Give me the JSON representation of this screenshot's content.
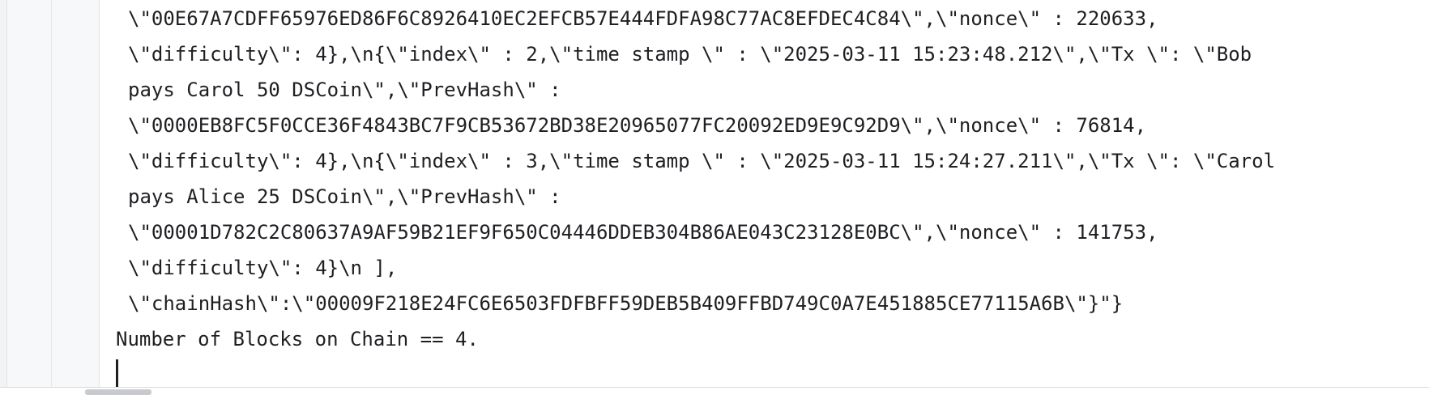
{
  "console": {
    "lines": [
      "\\\"00E67A7CDFF65976ED86F6C8926410EC2EFCB57E444FDFA98C77AC8EFDEC4C84\\\",\\\"nonce\\\" : 220633,",
      "\\\"difficulty\\\": 4},\\n{\\\"index\\\" : 2,\\\"time stamp \\\" : \\\"2025-03-11 15:23:48.212\\\",\\\"Tx \\\": \\\"Bob",
      "pays Carol 50 DSCoin\\\",\\\"PrevHash\\\" :",
      "\\\"0000EB8FC5F0CCE36F4843BC7F9CB53672BD38E20965077FC20092ED9E9C92D9\\\",\\\"nonce\\\" : 76814,",
      "\\\"difficulty\\\": 4},\\n{\\\"index\\\" : 3,\\\"time stamp \\\" : \\\"2025-03-11 15:24:27.211\\\",\\\"Tx \\\": \\\"Carol",
      "pays Alice 25 DSCoin\\\",\\\"PrevHash\\\" :",
      "\\\"00001D782C2C80637A9AF59B21EF9F650C04446DDEB304B86AE043C23128E0BC\\\",\\\"nonce\\\" : 141753,",
      "\\\"difficulty\\\": 4}\\n ],",
      "\\\"chainHash\\\":\\\"00009F218E24FC6E6503FDFBFF59DEB5B409FFBD749C0A7E451885CE77115A6B\\\"}\"}",
      "Number of Blocks on Chain == 4."
    ]
  }
}
